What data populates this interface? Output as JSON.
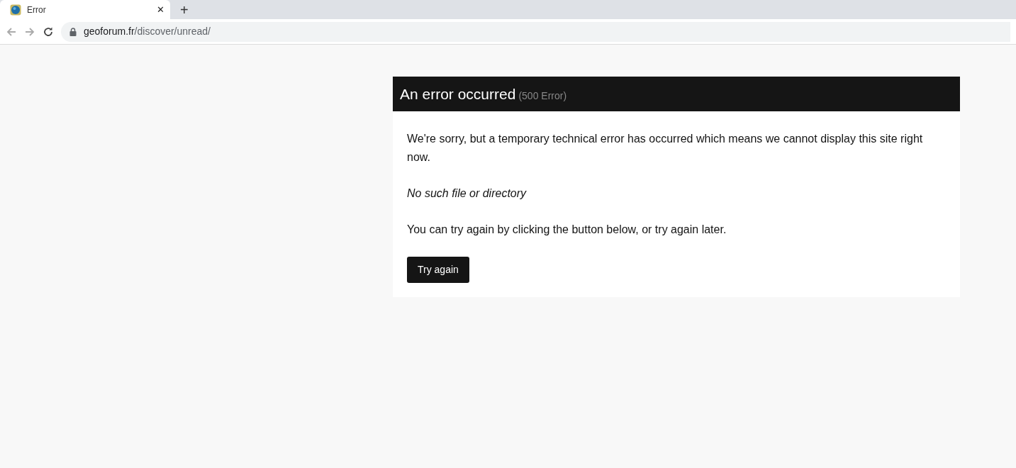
{
  "browser": {
    "tabs": [
      {
        "title": "Error",
        "selected": true
      }
    ],
    "close_glyph": "✕",
    "new_tab_glyph": "+",
    "url": {
      "host": "geoforum.fr",
      "path": "/discover/unread/"
    }
  },
  "error": {
    "title": "An error occurred",
    "code": "(500 Error)",
    "paragraphs": [
      {
        "kind": "plain",
        "text": "We're sorry, but a temporary technical error has occurred which means we cannot display this site right now."
      },
      {
        "kind": "detail",
        "text": "No such file or directory"
      },
      {
        "kind": "plain",
        "text": "You can try again by clicking the button below, or try again later."
      }
    ],
    "button": "Try again"
  }
}
